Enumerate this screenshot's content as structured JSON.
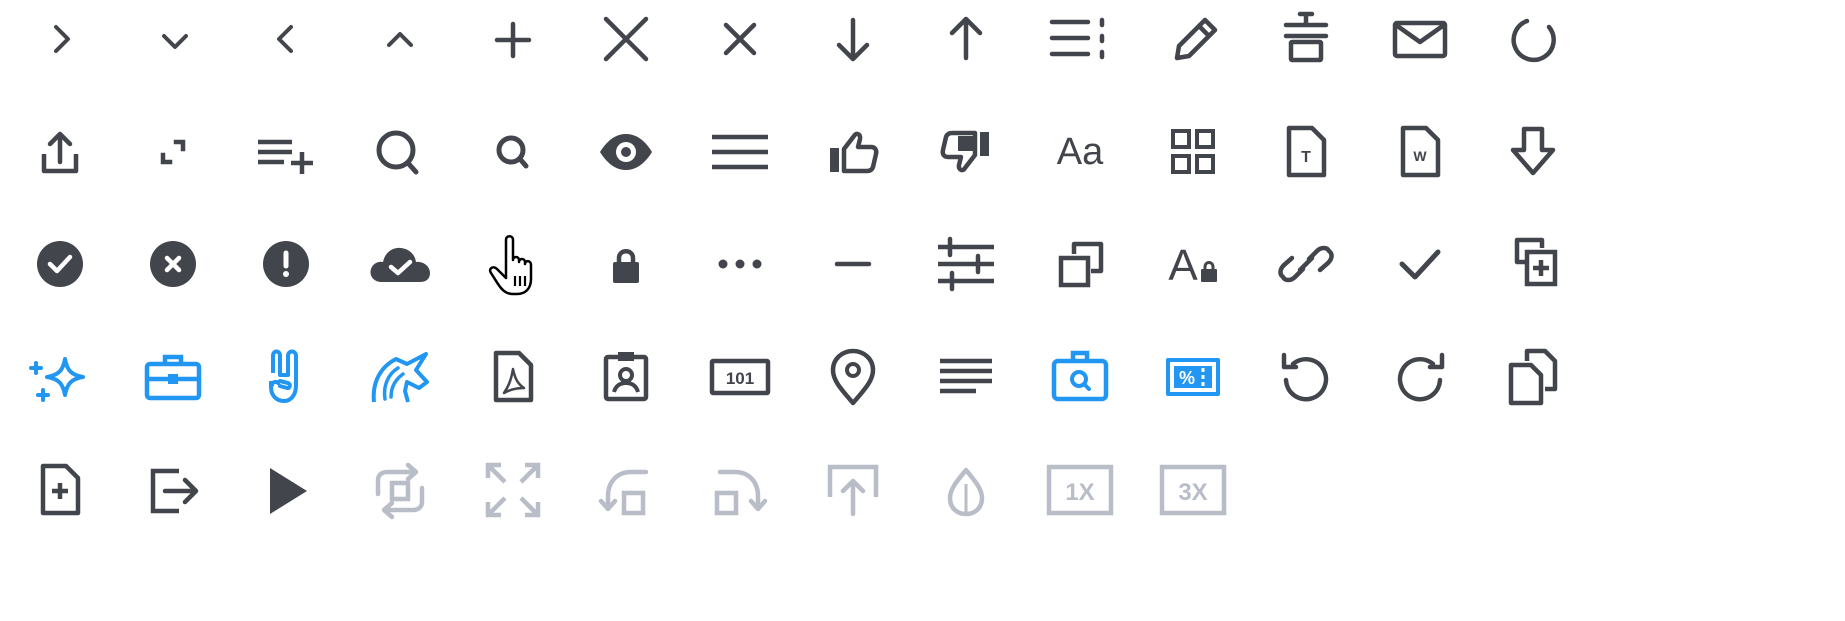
{
  "colors": {
    "dark": "#43454d",
    "blue": "#2196f3",
    "muted": "#b9bdc8",
    "white": "#ffffff"
  },
  "icons": [
    {
      "name": "chevron-right-icon",
      "tone": "dark"
    },
    {
      "name": "chevron-down-icon",
      "tone": "dark"
    },
    {
      "name": "chevron-left-icon",
      "tone": "dark"
    },
    {
      "name": "chevron-up-icon",
      "tone": "dark"
    },
    {
      "name": "plus-icon",
      "tone": "dark"
    },
    {
      "name": "close-large-icon",
      "tone": "dark"
    },
    {
      "name": "close-icon",
      "tone": "dark"
    },
    {
      "name": "arrow-down-icon",
      "tone": "dark"
    },
    {
      "name": "arrow-up-icon",
      "tone": "dark"
    },
    {
      "name": "list-dashed-icon",
      "tone": "dark"
    },
    {
      "name": "pencil-icon",
      "tone": "dark"
    },
    {
      "name": "trash-icon",
      "tone": "dark"
    },
    {
      "name": "mail-icon",
      "tone": "dark"
    },
    {
      "name": "spinner-icon",
      "tone": "dark"
    },
    {
      "name": "share-upload-icon",
      "tone": "dark"
    },
    {
      "name": "collapse-icon",
      "tone": "dark"
    },
    {
      "name": "playlist-add-icon",
      "tone": "dark"
    },
    {
      "name": "search-large-icon",
      "tone": "dark"
    },
    {
      "name": "search-small-icon",
      "tone": "dark"
    },
    {
      "name": "eye-icon",
      "tone": "dark"
    },
    {
      "name": "menu-lines-icon",
      "tone": "dark"
    },
    {
      "name": "thumbs-up-icon",
      "tone": "dark"
    },
    {
      "name": "thumbs-down-icon",
      "tone": "dark"
    },
    {
      "name": "font-size-icon",
      "tone": "dark",
      "text": "Aa"
    },
    {
      "name": "grid-view-icon",
      "tone": "dark"
    },
    {
      "name": "text-file-icon",
      "tone": "dark",
      "text": "T"
    },
    {
      "name": "word-file-icon",
      "tone": "dark",
      "text": "W"
    },
    {
      "name": "download-arrow-icon",
      "tone": "dark"
    },
    {
      "name": "check-circle-icon",
      "tone": "dark"
    },
    {
      "name": "error-circle-icon",
      "tone": "dark"
    },
    {
      "name": "warning-circle-icon",
      "tone": "dark"
    },
    {
      "name": "cloud-check-icon",
      "tone": "dark"
    },
    {
      "name": "hand-pointer-icon",
      "tone": "dark"
    },
    {
      "name": "lock-icon",
      "tone": "dark"
    },
    {
      "name": "more-dots-icon",
      "tone": "dark"
    },
    {
      "name": "minus-icon",
      "tone": "dark"
    },
    {
      "name": "sliders-icon",
      "tone": "dark"
    },
    {
      "name": "duplicate-icon",
      "tone": "dark"
    },
    {
      "name": "font-lock-icon",
      "tone": "dark",
      "text": "A"
    },
    {
      "name": "link-icon",
      "tone": "dark"
    },
    {
      "name": "checkmark-icon",
      "tone": "dark"
    },
    {
      "name": "add-copy-icon",
      "tone": "dark"
    },
    {
      "name": "sparkles-icon",
      "tone": "blue"
    },
    {
      "name": "briefcase-icon",
      "tone": "blue"
    },
    {
      "name": "rock-hand-icon",
      "tone": "blue"
    },
    {
      "name": "unicorn-icon",
      "tone": "blue"
    },
    {
      "name": "pdf-file-icon",
      "tone": "dark"
    },
    {
      "name": "id-badge-icon",
      "tone": "dark"
    },
    {
      "name": "bank-note-icon",
      "tone": "dark",
      "text": "101"
    },
    {
      "name": "location-pin-icon",
      "tone": "dark"
    },
    {
      "name": "align-left-icon",
      "tone": "dark"
    },
    {
      "name": "job-search-icon",
      "tone": "blue"
    },
    {
      "name": "coupon-icon",
      "tone": "blue",
      "text": "%"
    },
    {
      "name": "undo-icon",
      "tone": "dark"
    },
    {
      "name": "redo-icon",
      "tone": "dark"
    },
    {
      "name": "copy-files-icon",
      "tone": "dark"
    },
    {
      "name": "add-file-icon",
      "tone": "dark"
    },
    {
      "name": "logout-icon",
      "tone": "dark"
    },
    {
      "name": "play-icon",
      "tone": "dark"
    },
    {
      "name": "repeat-frame-icon",
      "tone": "muted"
    },
    {
      "name": "fullscreen-icon",
      "tone": "muted"
    },
    {
      "name": "rotate-left-icon",
      "tone": "muted"
    },
    {
      "name": "rotate-right-icon",
      "tone": "muted"
    },
    {
      "name": "upload-frame-icon",
      "tone": "muted"
    },
    {
      "name": "droplet-icon",
      "tone": "muted"
    },
    {
      "name": "speed-1x-icon",
      "tone": "muted",
      "text": "1X"
    },
    {
      "name": "speed-3x-icon",
      "tone": "muted",
      "text": "3X"
    }
  ]
}
